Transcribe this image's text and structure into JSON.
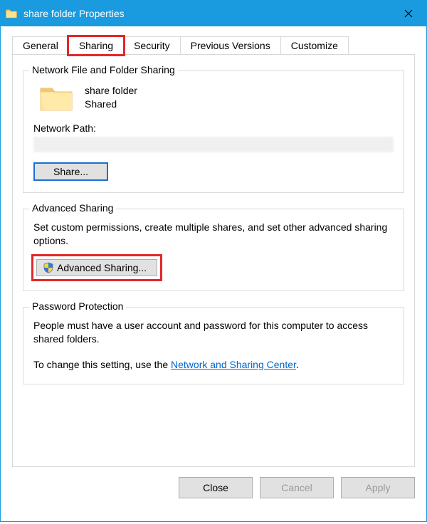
{
  "window": {
    "title": "share folder Properties"
  },
  "tabs": {
    "general": "General",
    "sharing": "Sharing",
    "security": "Security",
    "previous_versions": "Previous Versions",
    "customize": "Customize"
  },
  "network_sharing": {
    "group_label": "Network File and Folder Sharing",
    "folder_name": "share folder",
    "status": "Shared",
    "network_path_label": "Network Path:",
    "network_path_value": "",
    "share_button": "Share..."
  },
  "advanced_sharing": {
    "group_label": "Advanced Sharing",
    "description": "Set custom permissions, create multiple shares, and set other advanced sharing options.",
    "button": "Advanced Sharing..."
  },
  "password_protection": {
    "group_label": "Password Protection",
    "line1": "People must have a user account and password for this computer to access shared folders.",
    "line2_prefix": "To change this setting, use the ",
    "link_text": "Network and Sharing Center",
    "line2_suffix": "."
  },
  "footer": {
    "close": "Close",
    "cancel": "Cancel",
    "apply": "Apply"
  }
}
